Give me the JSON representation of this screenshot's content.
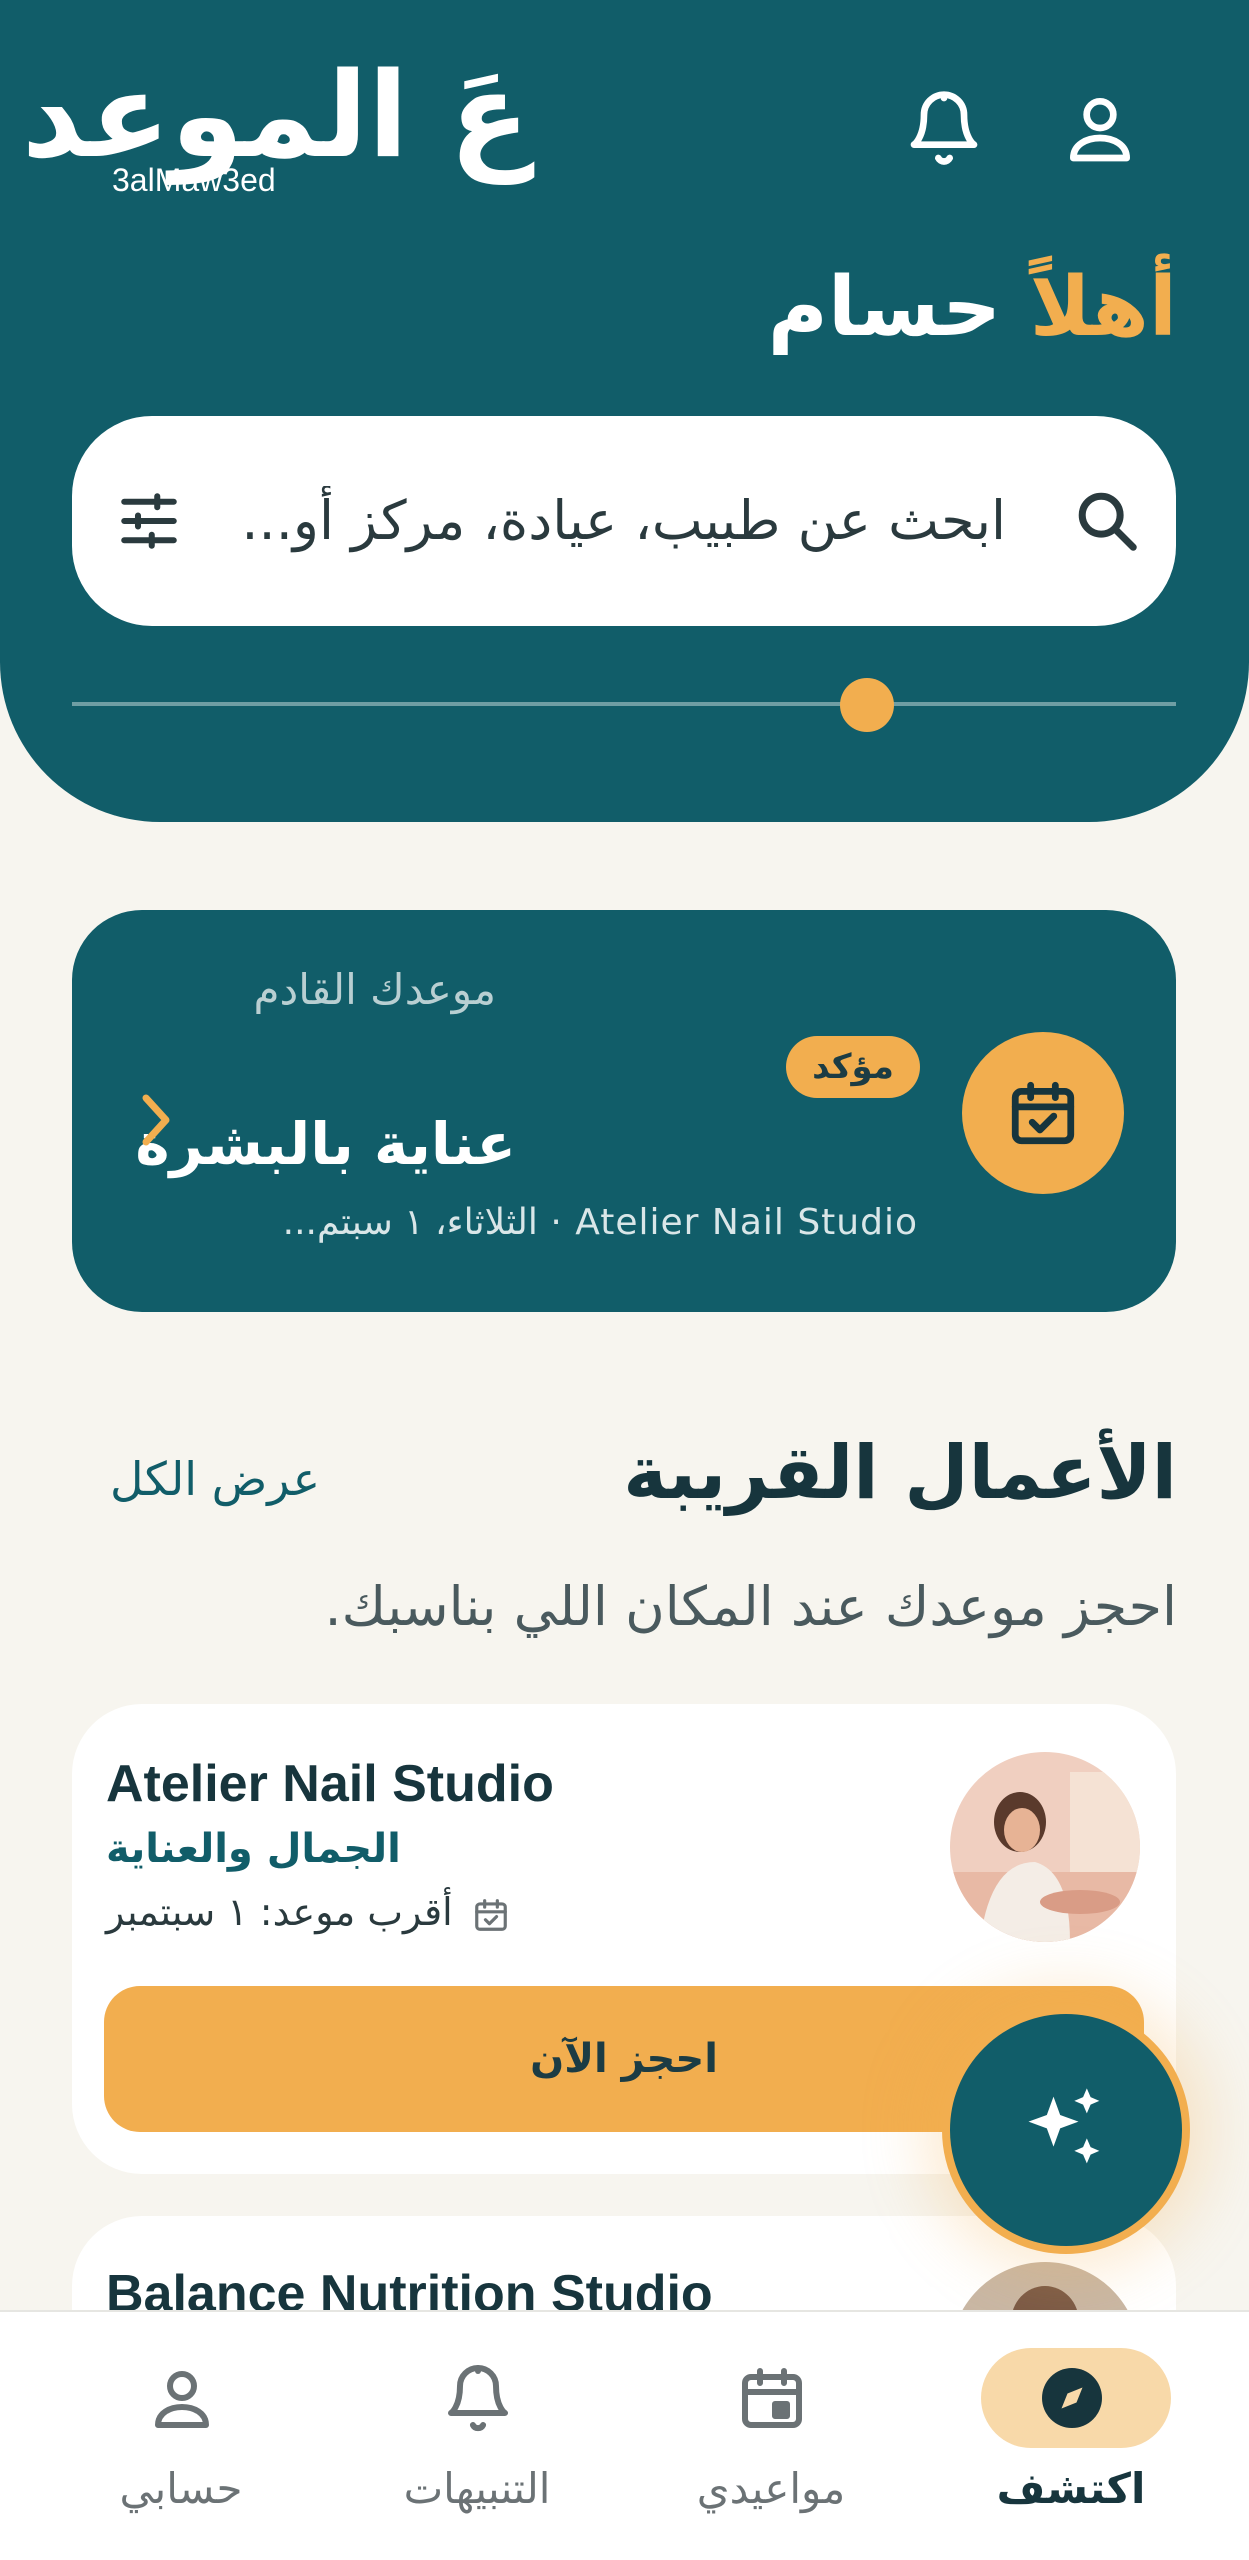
{
  "header": {
    "logo_ar": "عَ الموعد",
    "logo_en": "3alMaw3ed",
    "greeting_accent": "أهلاً",
    "greeting_name": "حسام"
  },
  "search": {
    "placeholder": "ابحث عن طبيب، عيادة، مركز أو..."
  },
  "upcoming": {
    "caption": "موعدك القادم",
    "status": "مؤكد",
    "title": "عناية بالبشرة",
    "subtitle": "Atelier Nail Studio · الثلاثاء، ١ سبتم..."
  },
  "nearby": {
    "title": "الأعمال القريبة",
    "see_all": "عرض الكل",
    "subtitle": "احجز موعدك عند المكان اللي بناسبك."
  },
  "businesses": [
    {
      "name": "Atelier Nail Studio",
      "category": "الجمال والعناية",
      "next": "أقرب موعد: ١ سبتمبر",
      "book": "احجز الآن"
    },
    {
      "name": "Balance Nutrition Studio"
    }
  ],
  "nav": [
    {
      "label": "اكتشف",
      "icon": "compass-icon",
      "active": true
    },
    {
      "label": "مواعيدي",
      "icon": "calendar-icon",
      "active": false
    },
    {
      "label": "التنبيهات",
      "icon": "bell-icon",
      "active": false
    },
    {
      "label": "حسابي",
      "icon": "user-icon",
      "active": false
    }
  ],
  "colors": {
    "primary": "#115d69",
    "accent": "#f2ae4f",
    "background": "#f7f5ef"
  }
}
